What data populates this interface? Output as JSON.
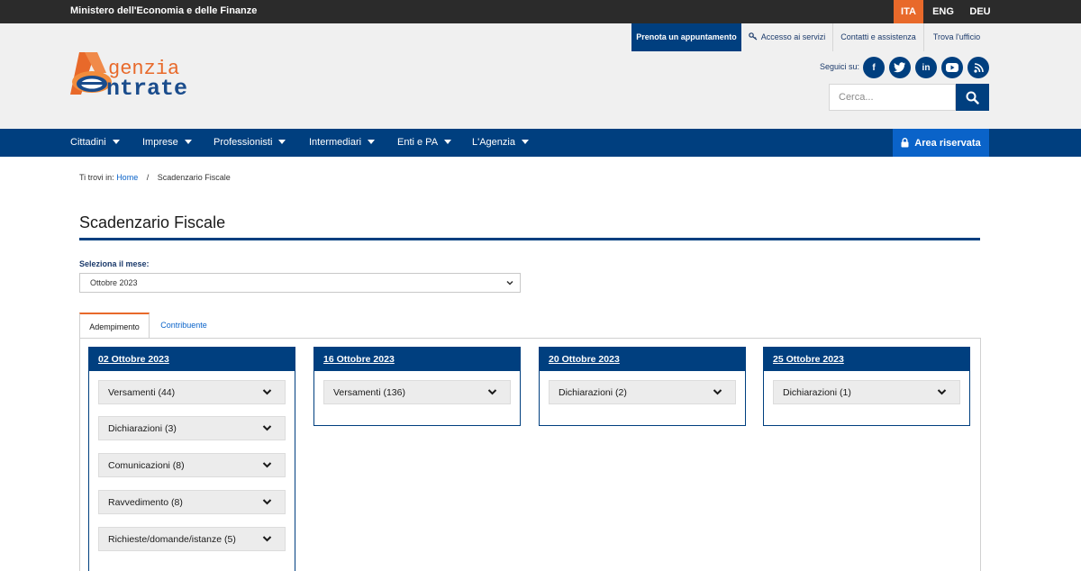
{
  "topbar": {
    "ministry": "Ministero dell'Economia e delle Finanze",
    "languages": [
      "ITA",
      "ENG",
      "DEU"
    ]
  },
  "utility": {
    "appointment": "Prenota un appuntamento",
    "services": "Accesso ai servizi",
    "contacts": "Contatti e assistenza",
    "office": "Trova l'ufficio"
  },
  "logo": {
    "line1": "genzia",
    "line2": "ntrate"
  },
  "social": {
    "label": "Seguici su:",
    "icons": [
      "facebook-icon",
      "twitter-icon",
      "linkedin-icon",
      "youtube-icon",
      "rss-icon"
    ]
  },
  "search": {
    "placeholder": "Cerca..."
  },
  "nav": {
    "items": [
      "Cittadini",
      "Imprese",
      "Professionisti",
      "Intermediari",
      "Enti e PA",
      "L'Agenzia"
    ],
    "reserved": "Area riservata"
  },
  "breadcrumb": {
    "prefix": "Ti trovi in:",
    "home": "Home",
    "current": "Scadenzario Fiscale"
  },
  "page": {
    "title": "Scadenzario Fiscale"
  },
  "month": {
    "label": "Seleziona il mese:",
    "selected": "Ottobre 2023"
  },
  "tabs": [
    "Adempimento",
    "Contribuente"
  ],
  "days": [
    {
      "date": "02 Ottobre 2023",
      "items": [
        "Versamenti (44)",
        "Dichiarazioni (3)",
        "Comunicazioni (8)",
        "Ravvedimento (8)",
        "Richieste/domande/istanze (5)"
      ]
    },
    {
      "date": "16 Ottobre 2023",
      "items": [
        "Versamenti (136)"
      ]
    },
    {
      "date": "20 Ottobre 2023",
      "items": [
        "Dichiarazioni (2)"
      ]
    },
    {
      "date": "25 Ottobre 2023",
      "items": [
        "Dichiarazioni (1)"
      ]
    }
  ],
  "colors": {
    "brand_blue": "#003f7f",
    "accent_orange": "#e8692a",
    "link_blue": "#0a63c9"
  }
}
